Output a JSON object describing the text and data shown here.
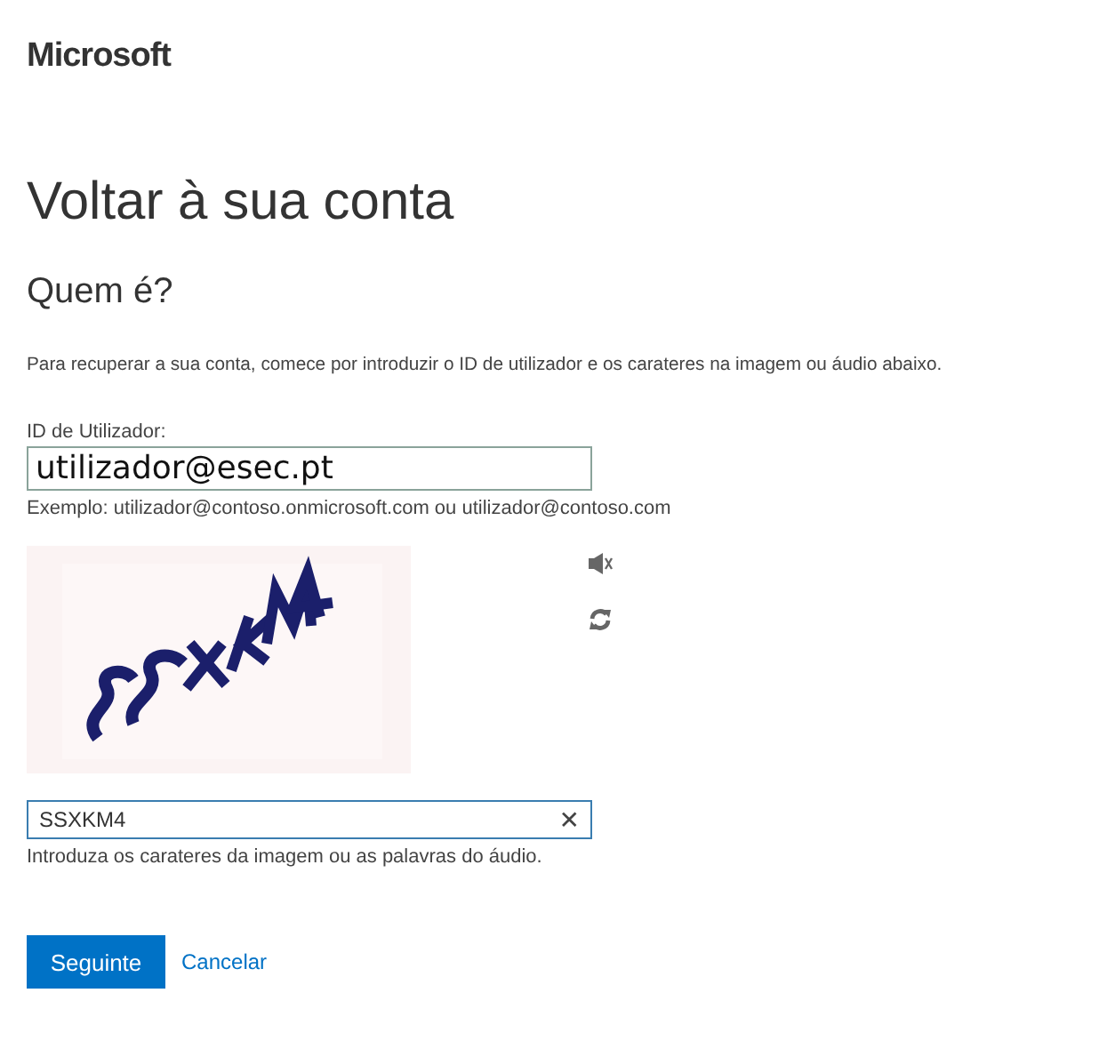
{
  "logo": "Microsoft",
  "title": "Voltar à sua conta",
  "subtitle": "Quem é?",
  "intro": "Para recuperar a sua conta, comece por introduzir o ID de utilizador e os carateres na imagem ou áudio abaixo.",
  "user_id": {
    "label": "ID de Utilizador:",
    "value": "utilizador@esec.pt",
    "hint": "Exemplo: utilizador@contoso.onmicrosoft.com ou utilizador@contoso.com"
  },
  "captcha": {
    "kind": "picture",
    "answer": "SSXKM4",
    "clear": "✕",
    "hint": "Introduza os carateres da imagem ou as palavras do áudio."
  },
  "buttons": [
    {
      "kind": "primary",
      "label": "Seguinte"
    },
    {
      "kind": "link",
      "label": "Cancelar"
    }
  ]
}
